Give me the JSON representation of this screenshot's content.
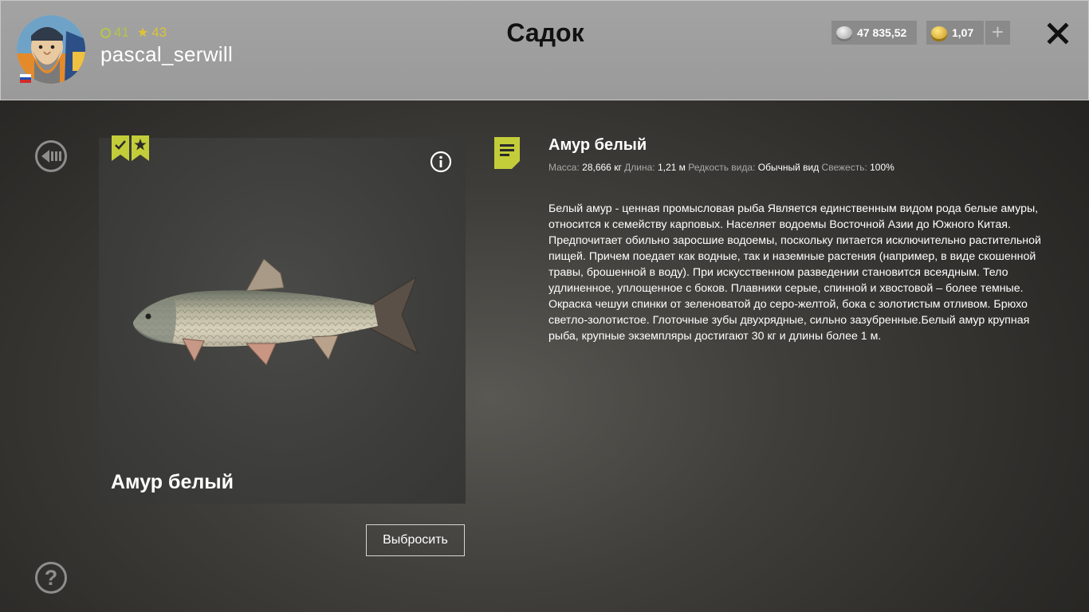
{
  "header": {
    "title": "Садок",
    "profile": {
      "username": "pascal_serwill",
      "level": "41",
      "rank": "43"
    },
    "currency": {
      "silver": "47 835,52",
      "gold": "1,07",
      "add_label": "+"
    },
    "close_label": "✕"
  },
  "fish": {
    "name": "Амур белый",
    "throw_label": "Выбросить"
  },
  "info": {
    "title": "Амур белый",
    "meta": {
      "mass_label": "Масса:",
      "mass_value": "28,666 кг",
      "length_label": "Длина:",
      "length_value": "1,21 м",
      "rarity_label": "Редкость вида:",
      "rarity_value": "Обычный вид",
      "freshness_label": "Свежесть:",
      "freshness_value": "100%"
    },
    "description": "Белый амур - ценная промысловая рыба Является единственным видом рода белые амуры, относится к семейству карповых. Населяет водоемы Восточной Азии до Южного Китая. Предпочитает обильно заросшие водоемы, поскольку питается исключительно растительной пищей. Причем поедает как водные, так и наземные растения (например, в виде скошенной травы, брошенной в воду). При искусственном разведении становится всеядным. Тело удлиненное, уплощенное с боков. Плавники серые, спинной и хвостовой – более темные. Окраска чешуи спинки от зеленоватой до серо-желтой, бока с золотистым отливом. Брюхо светло-золотистое. Глоточные зубы двухрядные, сильно зазубренные.Белый амур крупная рыба, крупные экземпляры достигают 30 кг и длины более 1 м."
  },
  "help_label": "?",
  "colors": {
    "accent_green": "#b5c548",
    "header_bg": "#a0a0a0",
    "badge_yellow": "#c3cd3a"
  },
  "icons": [
    "avatar",
    "russia-flag-icon",
    "level-ring-icon",
    "star-icon",
    "silver-coins-icon",
    "gold-coins-icon",
    "close-icon",
    "back-icon",
    "help-icon",
    "caught-badge-icon",
    "favorite-badge-icon",
    "info-icon",
    "document-icon",
    "fish-image"
  ]
}
